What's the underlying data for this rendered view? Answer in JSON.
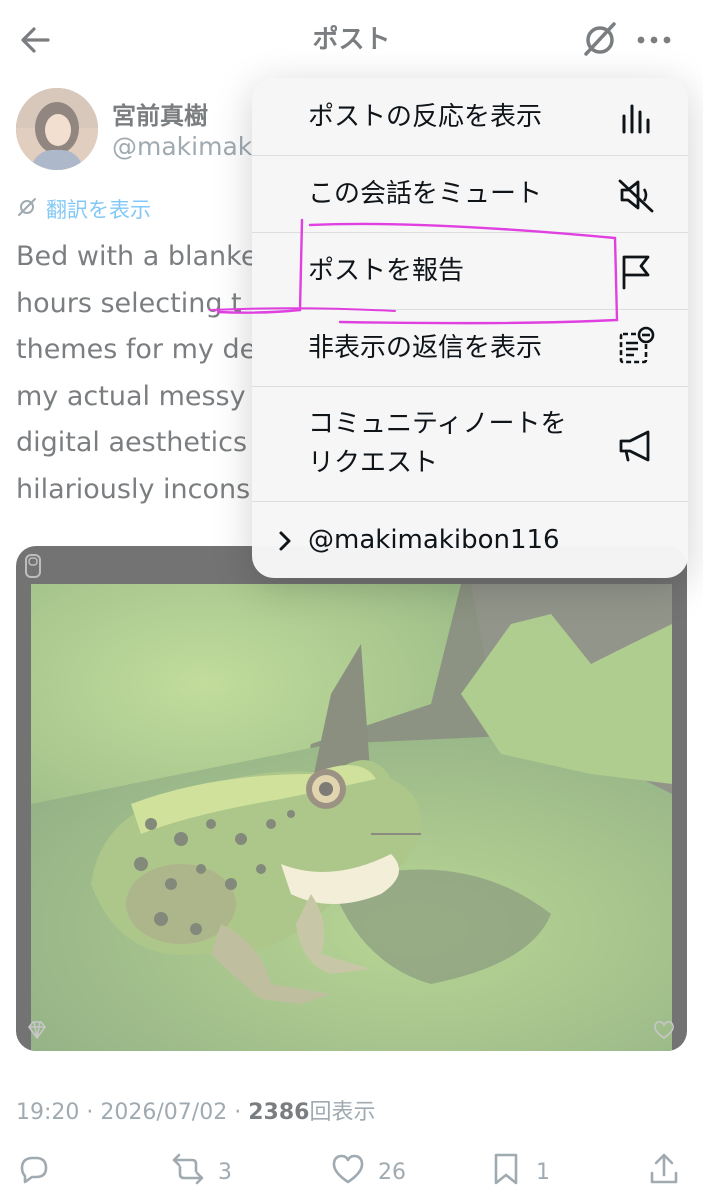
{
  "header": {
    "title": "ポスト"
  },
  "author": {
    "name": "宮前真樹",
    "handle": "@makimak"
  },
  "translate_label": "翻訳を表示",
  "tweet_lines": [
    "Bed with a blanke",
    "hours selecting t",
    "themes for my de",
    "my actual messy",
    "digital aesthetics",
    "hilariously incons"
  ],
  "menu": {
    "items": [
      {
        "label": "ポストの反応を表示",
        "icon": "analytics-icon"
      },
      {
        "label": "この会話をミュート",
        "icon": "mute-icon"
      },
      {
        "label": "ポストを報告",
        "icon": "flag-icon"
      },
      {
        "label": "非表示の返信を表示",
        "icon": "hidden-replies-icon"
      },
      {
        "label_line1": "コミュニティノートを",
        "label_line2": "リクエスト",
        "icon": "megaphone-icon"
      },
      {
        "label": "@makimakibon116",
        "icon": "chevron-right-icon"
      }
    ]
  },
  "meta": {
    "time": "19:20",
    "sep": "·",
    "date": "2026/07/02",
    "views": "2386",
    "views_label": "回表示"
  },
  "actions": {
    "retweets": "3",
    "likes": "26",
    "bookmarks": "1"
  },
  "colors": {
    "accent": "#1d9bf0",
    "annotation": "#e040e0",
    "text": "#0f1419",
    "muted": "#536471"
  }
}
